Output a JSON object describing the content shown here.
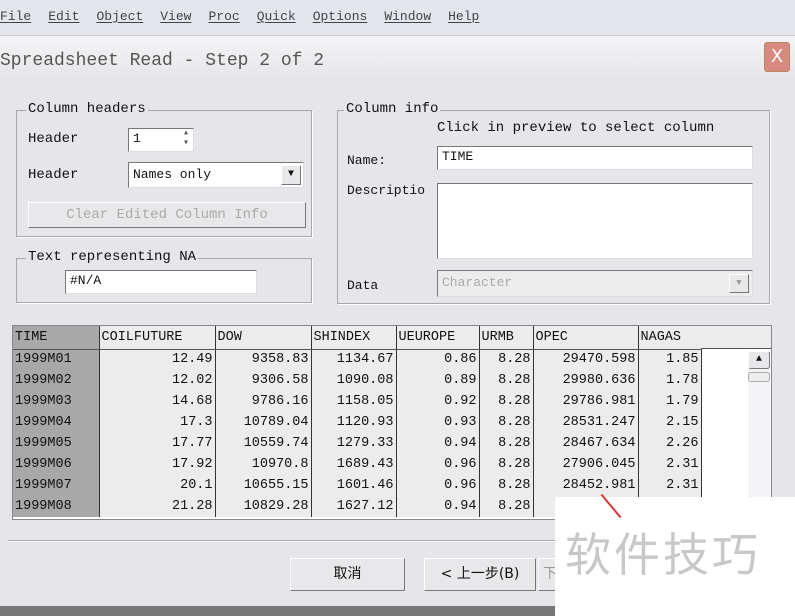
{
  "menu": [
    "File",
    "Edit",
    "Object",
    "View",
    "Proc",
    "Quick",
    "Options",
    "Window",
    "Help"
  ],
  "dialog": {
    "title": "Spreadsheet Read - Step 2 of 2",
    "close": "X"
  },
  "column_headers": {
    "legend": "Column headers",
    "header_label": "Header",
    "header_value": "1",
    "header2_label": "Header",
    "header2_value": "Names only",
    "clear_button": "Clear Edited Column Info"
  },
  "na": {
    "legend": "Text representing NA",
    "value": "#N/A"
  },
  "column_info": {
    "legend": "Column info",
    "hint": "Click in preview to select column",
    "name_label": "Name:",
    "name_value": "TIME",
    "desc_label": "Descriptio",
    "desc_value": "",
    "data_label": "Data",
    "data_value": "Character"
  },
  "grid": {
    "columns": [
      "TIME",
      "COILFUTURE",
      "DOW",
      "SHINDEX",
      "UEUROPE",
      "URMB",
      "OPEC",
      "NAGAS"
    ],
    "rows": [
      [
        "1999M01",
        "12.49",
        "9358.83",
        "1134.67",
        "0.86",
        "8.28",
        "29470.598",
        "1.85"
      ],
      [
        "1999M02",
        "12.02",
        "9306.58",
        "1090.08",
        "0.89",
        "8.28",
        "29980.636",
        "1.78"
      ],
      [
        "1999M03",
        "14.68",
        "9786.16",
        "1158.05",
        "0.92",
        "8.28",
        "29786.981",
        "1.79"
      ],
      [
        "1999M04",
        "17.3",
        "10789.04",
        "1120.93",
        "0.93",
        "8.28",
        "28531.247",
        "2.15"
      ],
      [
        "1999M05",
        "17.77",
        "10559.74",
        "1279.33",
        "0.94",
        "8.28",
        "28467.634",
        "2.26"
      ],
      [
        "1999M06",
        "17.92",
        "10970.8",
        "1689.43",
        "0.96",
        "8.28",
        "27906.045",
        "2.31"
      ],
      [
        "1999M07",
        "20.1",
        "10655.15",
        "1601.46",
        "0.96",
        "8.28",
        "28452.981",
        "2.31"
      ],
      [
        "1999M08",
        "21.28",
        "10829.28",
        "1627.12",
        "0.94",
        "8.28",
        "28",
        ""
      ]
    ]
  },
  "buttons": {
    "cancel": "取消",
    "back": "< 上一步(B)",
    "next": "下"
  },
  "watermark": "软件技巧"
}
